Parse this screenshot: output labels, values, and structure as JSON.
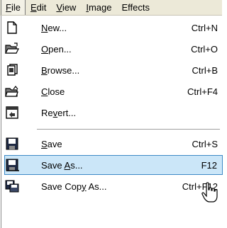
{
  "menubar": [
    {
      "label": "File",
      "mnemonic": "F",
      "rest": "ile",
      "active": true
    },
    {
      "label": "Edit",
      "mnemonic": "E",
      "rest": "dit",
      "active": false
    },
    {
      "label": "View",
      "mnemonic": "V",
      "rest": "iew",
      "active": false
    },
    {
      "label": "Image",
      "mnemonic": "I",
      "rest": "mage",
      "active": false
    },
    {
      "label": "Effects",
      "mnemonic": "",
      "rest": "Effects",
      "active": false
    }
  ],
  "file_menu": {
    "new": {
      "pre": "",
      "mnemonic": "N",
      "post": "ew...",
      "shortcut": "Ctrl+N",
      "icon": "new-document-icon"
    },
    "open": {
      "pre": "",
      "mnemonic": "O",
      "post": "pen...",
      "shortcut": "Ctrl+O",
      "icon": "open-folder-icon"
    },
    "browse": {
      "pre": "",
      "mnemonic": "B",
      "post": "rowse...",
      "shortcut": "Ctrl+B",
      "icon": "browse-icon"
    },
    "close": {
      "pre": "",
      "mnemonic": "C",
      "post": "lose",
      "shortcut": "Ctrl+F4",
      "icon": "close-folder-icon"
    },
    "revert": {
      "pre": "Re",
      "mnemonic": "v",
      "post": "ert...",
      "shortcut": "",
      "icon": "revert-icon"
    },
    "save": {
      "pre": "",
      "mnemonic": "S",
      "post": "ave",
      "shortcut": "Ctrl+S",
      "icon": "save-icon"
    },
    "save_as": {
      "pre": "Save ",
      "mnemonic": "A",
      "post": "s...",
      "shortcut": "F12",
      "icon": "save-as-icon",
      "highlighted": true
    },
    "save_copy": {
      "pre": "Save Cop",
      "mnemonic": "y",
      "post": " As...",
      "shortcut": "Ctrl+F12",
      "icon": "save-copy-icon"
    }
  },
  "colors": {
    "highlight_bg": "#cbe6f8",
    "highlight_border": "#3d89c6",
    "menubar_bg": "#ece9d8"
  }
}
